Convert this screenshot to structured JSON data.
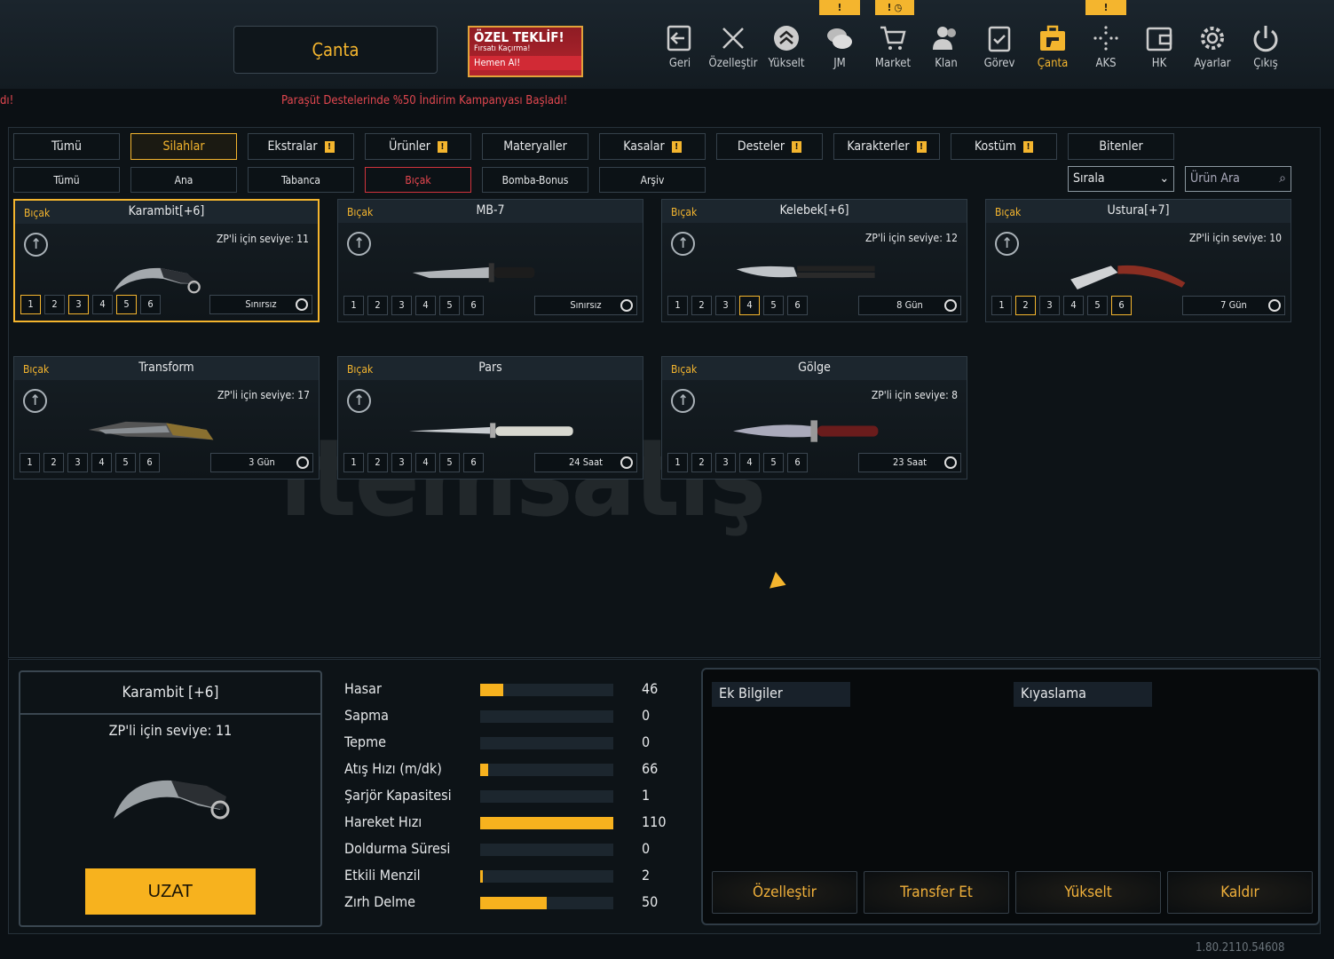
{
  "header": {
    "title": "Çanta",
    "offer": {
      "title": "ÖZEL TEKLİF!",
      "subtitle": "Fırsatı Kaçırma!",
      "cta": "Hemen Al!"
    },
    "nav": [
      {
        "label": "Geri",
        "icon": "exit-icon"
      },
      {
        "label": "Özelleştir",
        "icon": "tools-icon"
      },
      {
        "label": "Yükselt",
        "icon": "upgrade-icon"
      },
      {
        "label": "JM",
        "icon": "coins-icon",
        "badge": "!"
      },
      {
        "label": "Market",
        "icon": "cart-icon",
        "badge": "! ◷"
      },
      {
        "label": "Klan",
        "icon": "users-icon"
      },
      {
        "label": "Görev",
        "icon": "clipboard-icon"
      },
      {
        "label": "Çanta",
        "icon": "bag-icon",
        "active": true
      },
      {
        "label": "AKS",
        "icon": "dots-icon",
        "badge": "!"
      },
      {
        "label": "HK",
        "icon": "wallet-icon"
      },
      {
        "label": "Ayarlar",
        "icon": "gear-icon"
      },
      {
        "label": "Çıkış",
        "icon": "power-icon"
      }
    ]
  },
  "ticker": {
    "left": "dı!",
    "main": "Paraşüt Destelerinde %50 İndirim Kampanyası Başladı!"
  },
  "categories": [
    {
      "label": "Tümü"
    },
    {
      "label": "Silahlar",
      "selected": true
    },
    {
      "label": "Ekstralar",
      "warn": true
    },
    {
      "label": "Ürünler",
      "warn": true
    },
    {
      "label": "Materyaller"
    },
    {
      "label": "Kasalar",
      "warn": true
    },
    {
      "label": "Desteler",
      "warn": true
    },
    {
      "label": "Karakterler",
      "warn": true
    },
    {
      "label": "Kostüm",
      "warn": true
    },
    {
      "label": "Bitenler"
    }
  ],
  "subcategories": [
    {
      "label": "Tümü"
    },
    {
      "label": "Ana"
    },
    {
      "label": "Tabanca"
    },
    {
      "label": "Bıçak",
      "selected": true
    },
    {
      "label": "Bomba-Bonus"
    },
    {
      "label": "Arşiv"
    }
  ],
  "sort": {
    "label": "Sırala"
  },
  "search": {
    "placeholder": "Ürün Ara"
  },
  "items": [
    {
      "category": "Bıçak",
      "name": "Karambit[+6]",
      "level": "ZP'li için seviye: 11",
      "slots": [
        1,
        3,
        5
      ],
      "duration": "Sınırsız",
      "selected": true,
      "shape": "karambit"
    },
    {
      "category": "Bıçak",
      "name": "MB-7",
      "level": "",
      "slots": [],
      "duration": "Sınırsız",
      "shape": "combat"
    },
    {
      "category": "Bıçak",
      "name": "Kelebek[+6]",
      "level": "ZP'li için seviye: 12",
      "slots": [
        4
      ],
      "duration": "8 Gün",
      "shape": "butterfly"
    },
    {
      "category": "Bıçak",
      "name": "Ustura[+7]",
      "level": "ZP'li için seviye: 10",
      "slots": [
        2,
        6
      ],
      "duration": "7 Gün",
      "shape": "razor"
    },
    {
      "category": "Bıçak",
      "name": "Transform",
      "level": "ZP'li için seviye: 17",
      "slots": [],
      "duration": "3 Gün",
      "shape": "transform"
    },
    {
      "category": "Bıçak",
      "name": "Pars",
      "level": "",
      "slots": [],
      "duration": "24 Saat",
      "shape": "stiletto"
    },
    {
      "category": "Bıçak",
      "name": "Gölge",
      "level": "ZP'li için seviye: 8",
      "slots": [],
      "duration": "23 Saat",
      "shape": "dagger"
    }
  ],
  "detail": {
    "name": "Karambit [+6]",
    "level": "ZP'li için seviye: 11",
    "extend": "UZAT",
    "stats": [
      {
        "label": "Hasar",
        "value": "46",
        "fill": 0.17
      },
      {
        "label": "Sapma",
        "value": "0",
        "fill": 0
      },
      {
        "label": "Tepme",
        "value": "0",
        "fill": 0
      },
      {
        "label": "Atış Hızı (m/dk)",
        "value": "66",
        "fill": 0.06
      },
      {
        "label": "Şarjör Kapasitesi",
        "value": "1",
        "fill": 0
      },
      {
        "label": "Hareket Hızı",
        "value": "110",
        "fill": 1
      },
      {
        "label": "Doldurma Süresi",
        "value": "0",
        "fill": 0
      },
      {
        "label": "Etkili Menzil",
        "value": "2",
        "fill": 0.02
      },
      {
        "label": "Zırh Delme",
        "value": "50",
        "fill": 0.5
      }
    ]
  },
  "info": {
    "extra": "Ek Bilgiler",
    "compare": "Kıyaslama",
    "actions": [
      "Özelleştir",
      "Transfer Et",
      "Yükselt",
      "Kaldır"
    ]
  },
  "watermark": "itemsatış",
  "version": "1.80.2110.54608",
  "colors": {
    "accent": "#f4b52e",
    "alert": "#e2474f"
  }
}
